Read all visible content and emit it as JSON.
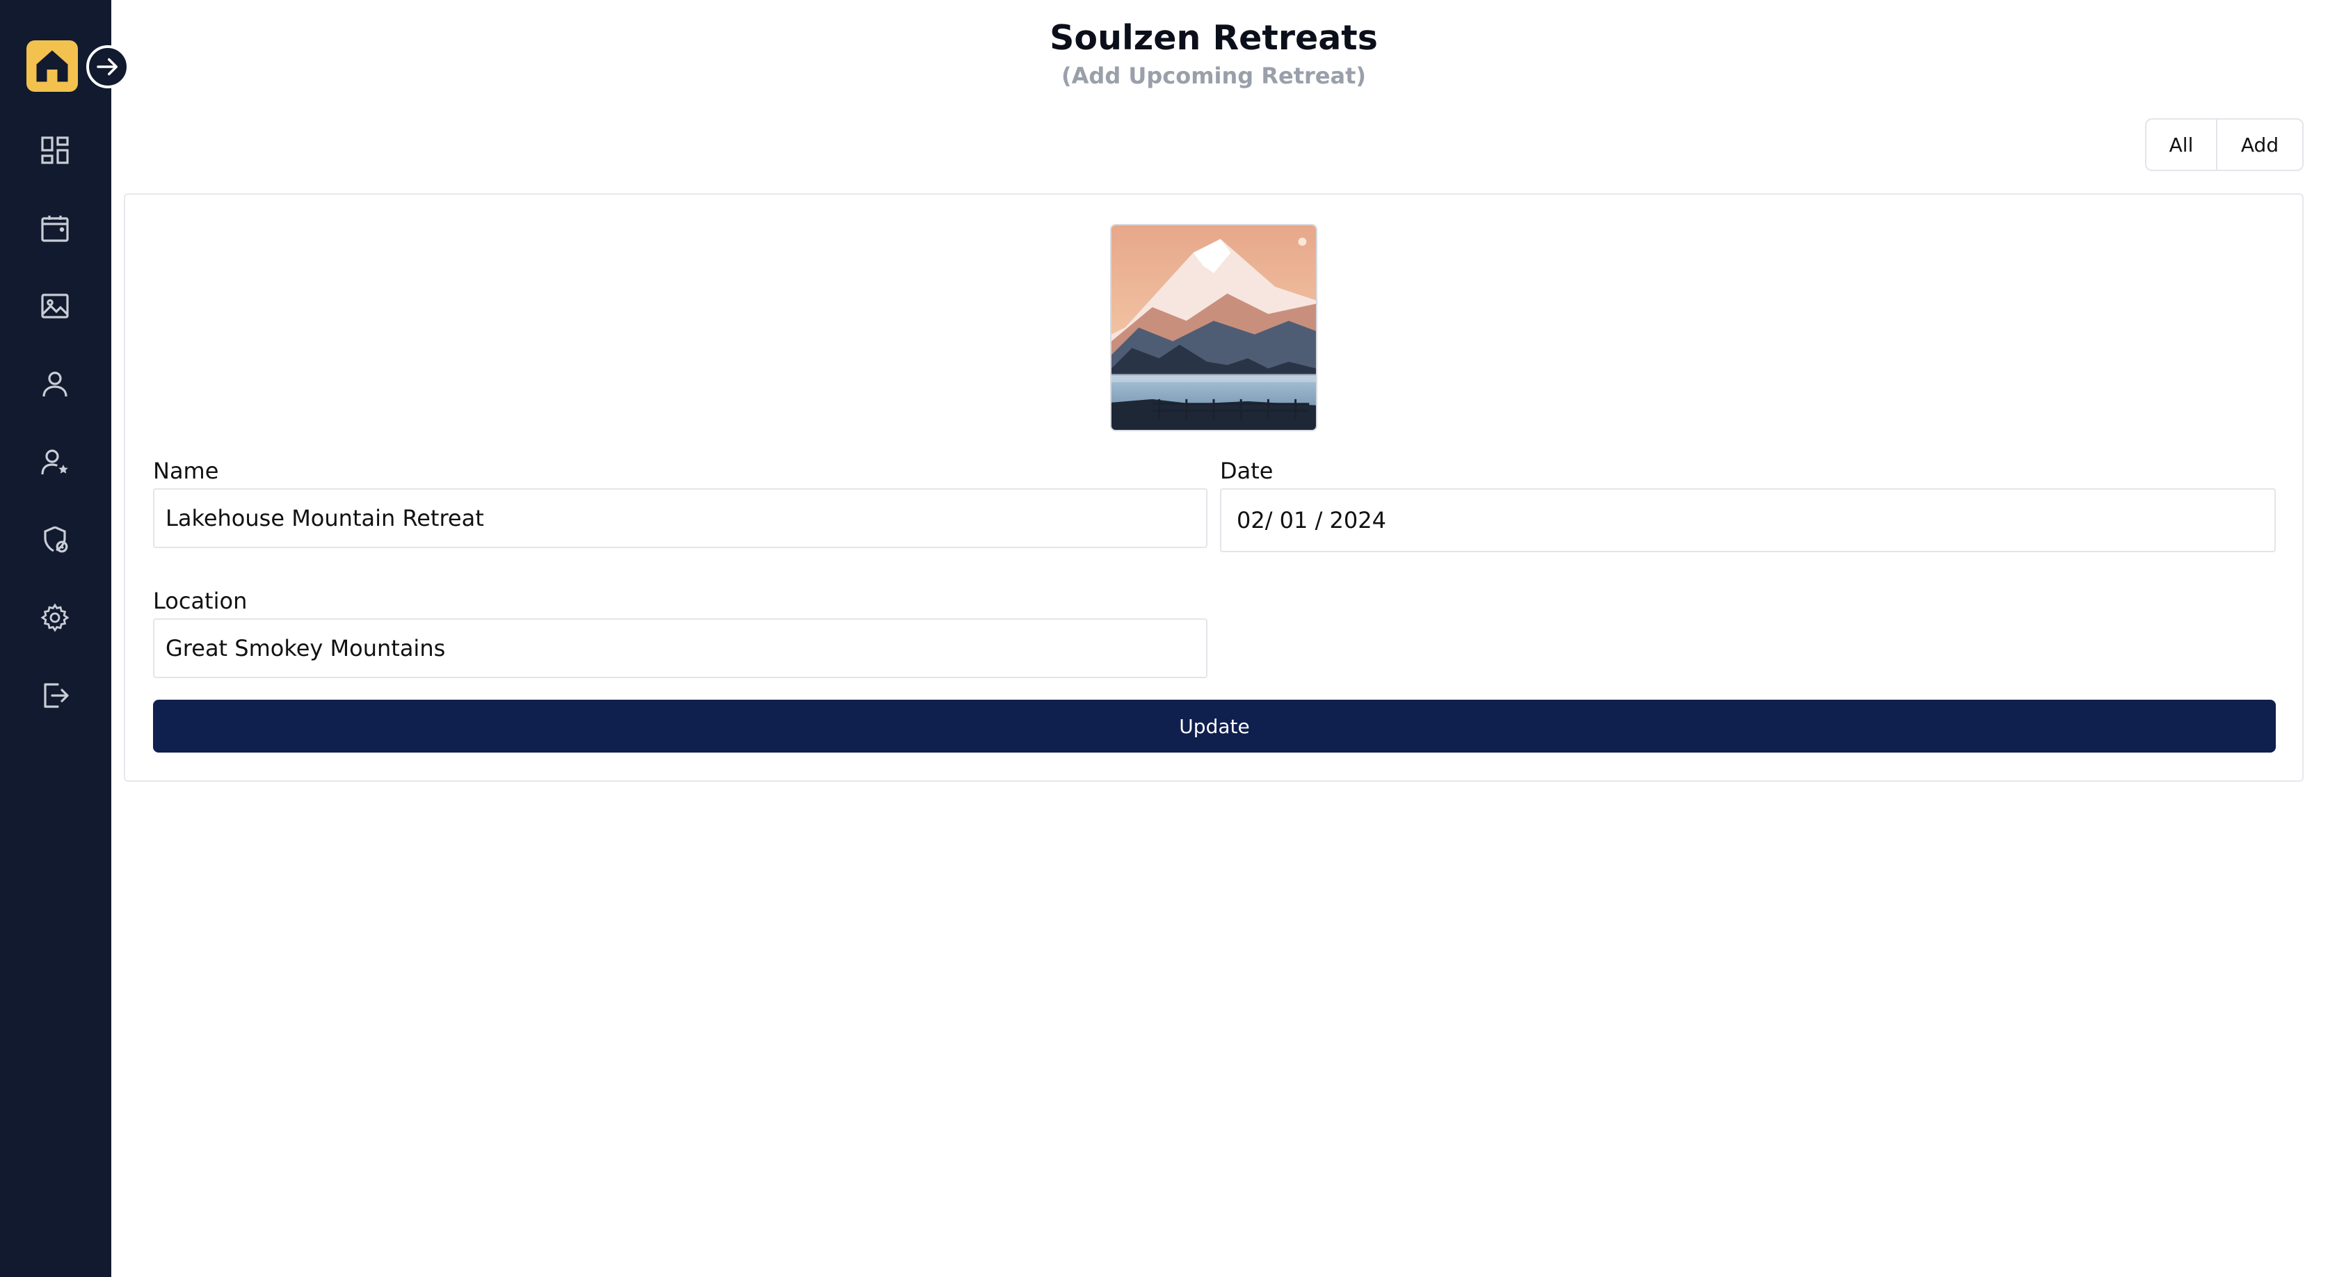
{
  "header": {
    "title": "Soulzen Retreats",
    "subtitle": "(Add Upcoming Retreat)"
  },
  "toolbar": {
    "all_label": "All",
    "add_label": "Add"
  },
  "sidebar": {
    "items": [
      {
        "icon": "dashboard-icon"
      },
      {
        "icon": "calendar-icon"
      },
      {
        "icon": "image-icon"
      },
      {
        "icon": "user-icon"
      },
      {
        "icon": "user-star-icon"
      },
      {
        "icon": "shield-icon"
      },
      {
        "icon": "gear-icon"
      },
      {
        "icon": "logout-icon"
      }
    ]
  },
  "form": {
    "name_label": "Name",
    "name_value": "Lakehouse Mountain Retreat",
    "date_label": "Date",
    "date_value": "02/ 01 / 2024",
    "location_label": "Location",
    "location_value": "Great Smokey Mountains",
    "update_label": "Update"
  },
  "colors": {
    "sidebar_bg": "#111a2e",
    "home_accent": "#f2c14e",
    "primary_button": "#0f1f4e"
  }
}
